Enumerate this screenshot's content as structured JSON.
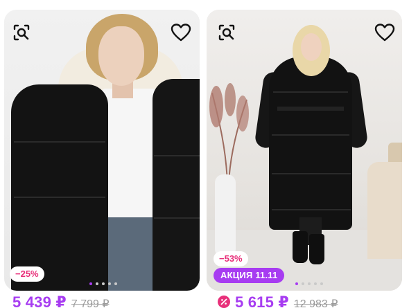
{
  "products": [
    {
      "discount_label": "−25%",
      "promo_label": "",
      "price_current": "5 439 ₽",
      "price_old": "7 799 ₽",
      "photo_count": 5,
      "active_photo": 0,
      "actions": {
        "similar_icon": "similar-search-icon",
        "favorite_icon": "heart-icon"
      }
    },
    {
      "discount_label": "−53%",
      "promo_label": "АКЦИЯ 11.11",
      "price_current": "5 615 ₽",
      "price_old": "12 983 ₽",
      "photo_count": 5,
      "active_photo": 0,
      "actions": {
        "similar_icon": "similar-search-icon",
        "favorite_icon": "heart-icon"
      }
    }
  ],
  "colors": {
    "accent_purple": "#a73cf1",
    "discount_pink": "#e8307a",
    "old_price_gray": "#9a9a9a"
  }
}
